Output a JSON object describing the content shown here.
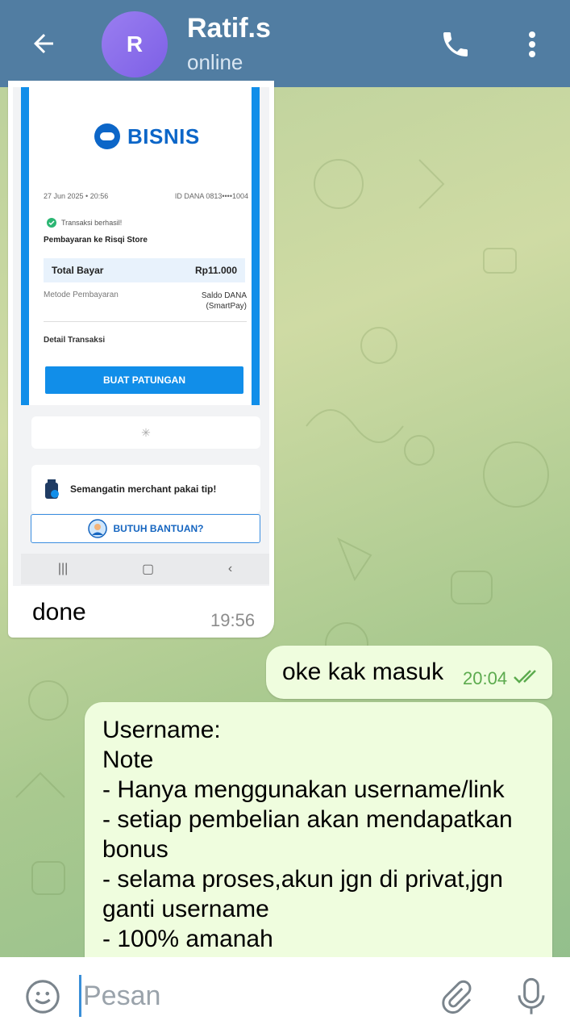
{
  "header": {
    "contact_name": "Ratif.s",
    "status": "online",
    "avatar_letter": "R"
  },
  "messages": [
    {
      "type": "image",
      "direction": "incoming",
      "caption": "done",
      "time": "19:56",
      "receipt": {
        "brand": "BISNIS",
        "date": "27 Jun 2025 • 20:56",
        "dana_id": "ID DANA 0813••••1004",
        "status": "Transaksi berhasil!",
        "merchant": "Pembayaran ke Risqi Store",
        "total_label": "Total Bayar",
        "total_value": "Rp11.000",
        "method_label": "Metode Pembayaran",
        "method_value": "Saldo DANA (SmartPay)",
        "detail_label": "Detail Transaksi",
        "button_label": "BUAT PATUNGAN",
        "tip_text": "Semangatin merchant pakai tip!",
        "help_label": "BUTUH BANTUAN?"
      }
    },
    {
      "type": "text",
      "direction": "outgoing",
      "text": "oke kak masuk",
      "time": "20:04",
      "status": "read"
    },
    {
      "type": "text",
      "direction": "outgoing",
      "text": "Username:\nNote\n- Hanya menggunakan username/link\n- setiap pembelian akan mendapatkan bonus\n- selama proses,akun jgn di privat,jgn ganti username\n- 100% amanah"
    }
  ],
  "input": {
    "placeholder": "Pesan",
    "value": ""
  },
  "icons": {
    "back": "arrow-left-icon",
    "call": "phone-icon",
    "menu": "more-vertical-icon",
    "emoji": "smiley-icon",
    "attach": "paperclip-icon",
    "mic": "microphone-icon"
  },
  "colors": {
    "header": "#517da2",
    "outgoing_bubble": "#effdde",
    "incoming_bubble": "#ffffff",
    "read_time": "#5cab4e",
    "dana_blue": "#118ee9"
  }
}
